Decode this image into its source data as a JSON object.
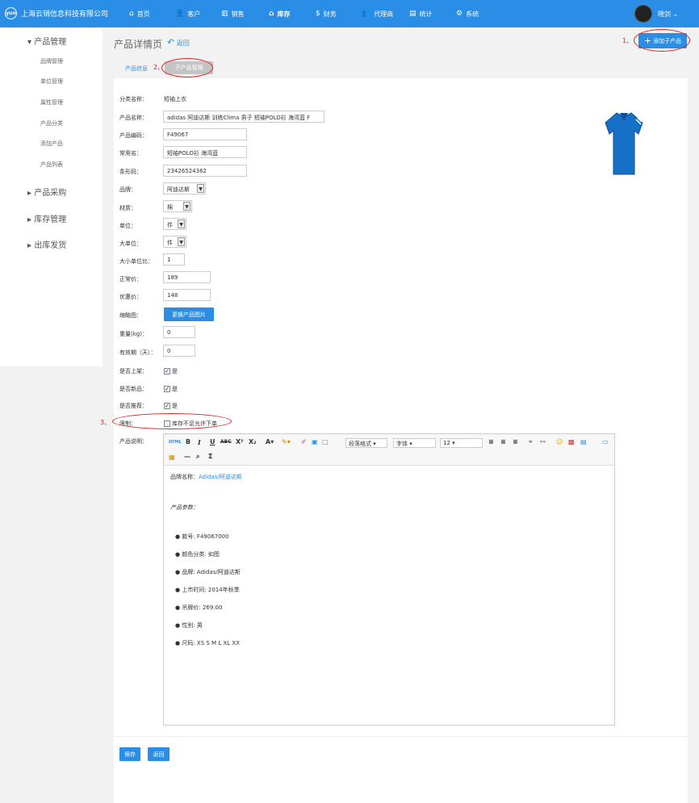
{
  "app": {
    "company": "上海云销信息科技有限公司",
    "logo_text": "yun"
  },
  "nav": [
    {
      "label": "首页",
      "icon": "home-icon",
      "glyph": "⌂"
    },
    {
      "label": "客户",
      "icon": "user-icon",
      "glyph": "👤"
    },
    {
      "label": "销售",
      "icon": "chart-icon",
      "glyph": "▥"
    },
    {
      "label": "库存",
      "icon": "warehouse-icon",
      "glyph": "⌂"
    },
    {
      "label": "财务",
      "icon": "money-icon",
      "glyph": "$"
    },
    {
      "label": "代理商",
      "icon": "agents-icon",
      "glyph": "👥"
    },
    {
      "label": "统计",
      "icon": "stats-icon",
      "glyph": "▤"
    },
    {
      "label": "系统",
      "icon": "gear-icon",
      "glyph": "⚙"
    }
  ],
  "user": {
    "name": "晓剑"
  },
  "sidebar": {
    "groups": [
      {
        "label": "产品管理",
        "expanded": true
      },
      {
        "label": "产品采购"
      },
      {
        "label": "库存管理"
      },
      {
        "label": "出库发货"
      }
    ],
    "items": [
      "品牌管理",
      "单位管理",
      "属性管理",
      "产品分类",
      "添加产品",
      "产品列表"
    ]
  },
  "page": {
    "title": "产品详情页",
    "back": "返回",
    "add_child": "添加子产品"
  },
  "tabs": [
    "产品信息",
    "子产品管理"
  ],
  "annotations": [
    "1、",
    "2、",
    "3、"
  ],
  "form": {
    "category_label": "分类名称：",
    "category": "短袖上衣",
    "name_label": "产品名称：",
    "name": "adidas 阿迪达斯 训练Clima 男子 短袖POLO衫 海湾蓝 F",
    "code_label": "产品编码：",
    "code": "F49067",
    "common_label": "常用名：",
    "common": "短袖POLO衫 海湾蓝",
    "barcode_label": "条形码：",
    "barcode": "23426524362",
    "brand_label": "品牌：",
    "brand": "阿迪达斯",
    "material_label": "材质：",
    "material": "棉",
    "unit_label": "单位：",
    "unit": "件",
    "bigunit_label": "大单位：",
    "bigunit": "件",
    "ratio_label": "大小单位比：",
    "ratio": "1",
    "price_label": "正常价：",
    "price": "189",
    "discount_label": "优惠价：",
    "discount": "148",
    "thumb_label": "缩略图：",
    "thumb_btn": "更换产品图片",
    "weight_label": "重量(kg)：",
    "weight": "0",
    "validity_label": "有效期（天）：",
    "validity": "0",
    "onshelf_label": "是否上架：",
    "onshelf": "是",
    "isnew_label": "是否新品：",
    "isnew": "是",
    "recommend_label": "是否推荐：",
    "recommend": "是",
    "limit_label": "限制：",
    "limit": "库存不足允许下单",
    "desc_label": "产品说明："
  },
  "editor": {
    "para_format": "段落格式",
    "font": "字体",
    "size": "12",
    "brand_prefix": "品牌名称：",
    "brand_link": "Adidas/阿迪达斯",
    "params_title": "产品参数：",
    "params": [
      "款号: F49067000",
      "颜色分类: 如图",
      "品牌: Adidas/阿迪达斯",
      "上市时间: 2014年秋季",
      "吊牌价: 269.00",
      "性别: 男",
      "尺码: XS S M L XL XX"
    ]
  },
  "buttons": {
    "save": "保存",
    "back": "返回"
  },
  "colors": {
    "topbar": "#2a8de6",
    "accent": "#2a8de6",
    "annotation": "#e02020"
  }
}
